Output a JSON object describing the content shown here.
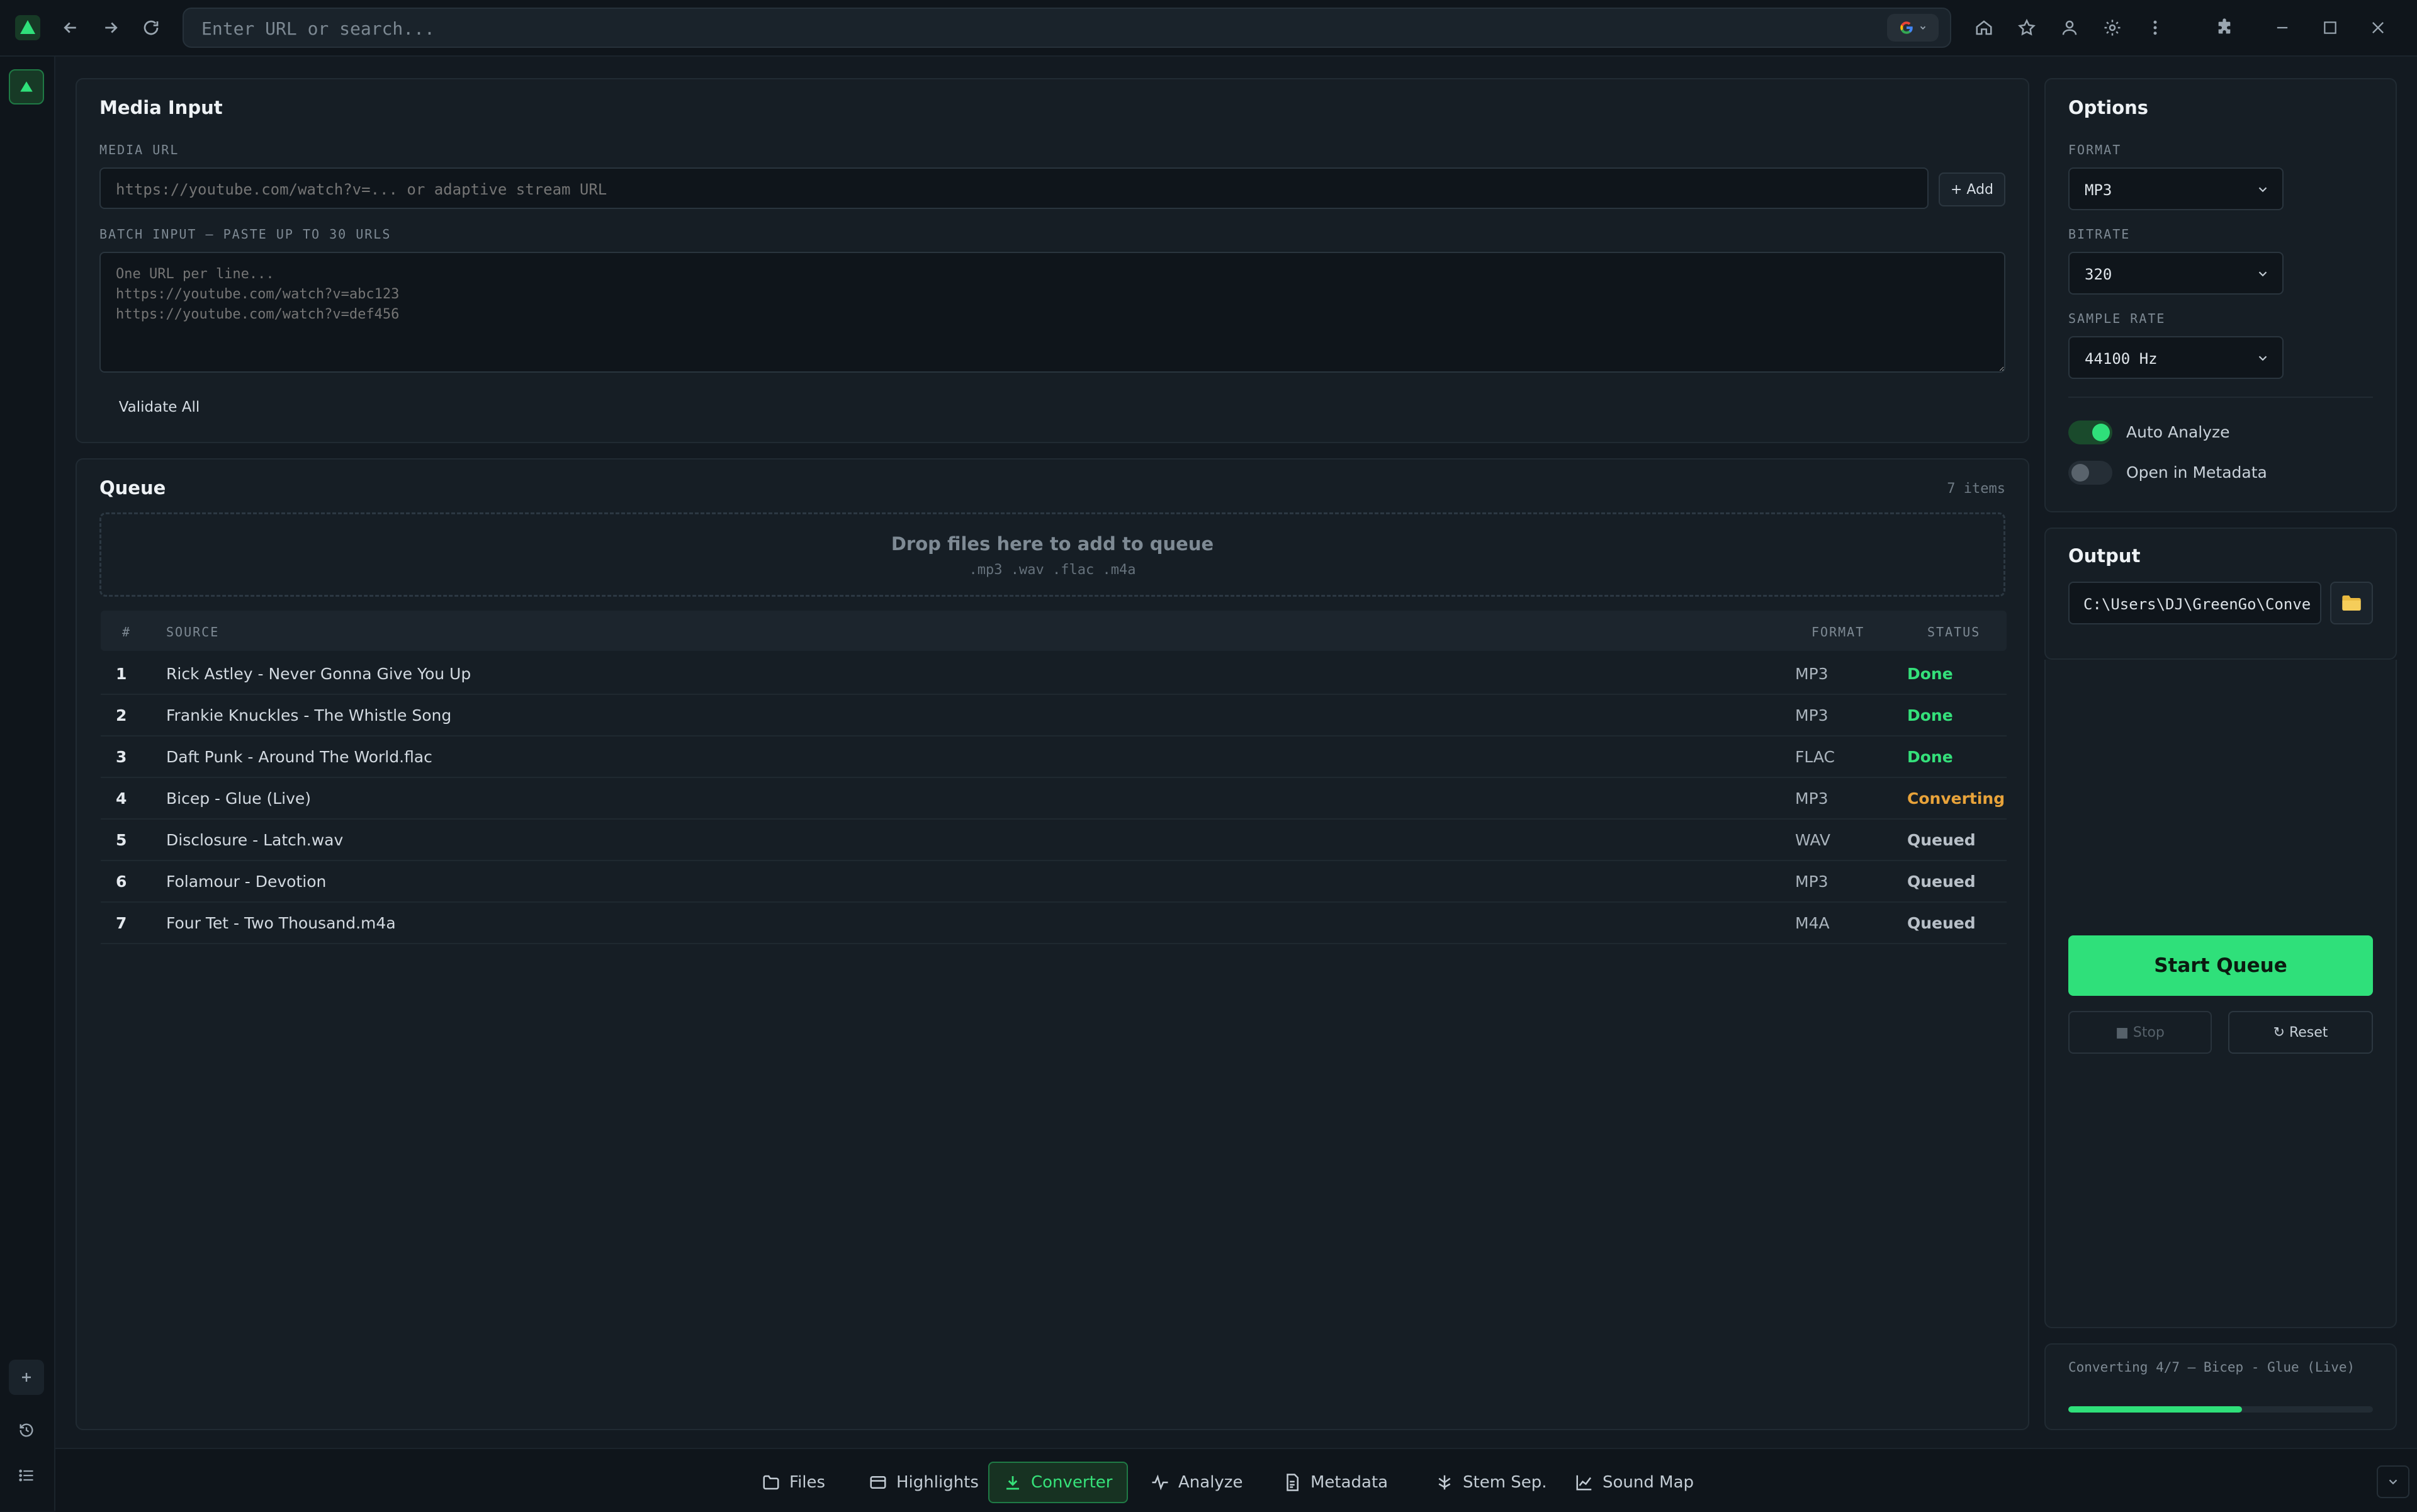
{
  "browser": {
    "url_placeholder": "Enter URL or search..."
  },
  "media_input": {
    "title": "Media Input",
    "media_url_label": "MEDIA URL",
    "media_url_placeholder": "https://youtube.com/watch?v=... or adaptive stream URL",
    "add_label": "+ Add",
    "batch_label": "BATCH INPUT — PASTE UP TO 30 URLS",
    "batch_placeholder": "One URL per line...\nhttps://youtube.com/watch?v=abc123\nhttps://youtube.com/watch?v=def456",
    "validate_label": "Validate All"
  },
  "queue": {
    "title": "Queue",
    "count": "7 items",
    "drop_title": "Drop files here to add to queue",
    "drop_formats": ".mp3 .wav .flac .m4a",
    "headers": {
      "num": "#",
      "source": "SOURCE",
      "format": "FORMAT",
      "status": "STATUS"
    },
    "rows": [
      {
        "num": "1",
        "source": "Rick Astley - Never Gonna Give You Up",
        "format": "MP3",
        "status": "Done"
      },
      {
        "num": "2",
        "source": "Frankie Knuckles - The Whistle Song",
        "format": "MP3",
        "status": "Done"
      },
      {
        "num": "3",
        "source": "Daft Punk - Around The World.flac",
        "format": "FLAC",
        "status": "Done"
      },
      {
        "num": "4",
        "source": "Bicep - Glue (Live)",
        "format": "MP3",
        "status": "Converting"
      },
      {
        "num": "5",
        "source": "Disclosure - Latch.wav",
        "format": "WAV",
        "status": "Queued"
      },
      {
        "num": "6",
        "source": "Folamour - Devotion",
        "format": "MP3",
        "status": "Queued"
      },
      {
        "num": "7",
        "source": "Four Tet - Two Thousand.m4a",
        "format": "M4A",
        "status": "Queued"
      }
    ]
  },
  "options": {
    "title": "Options",
    "format_label": "FORMAT",
    "format_value": "MP3",
    "bitrate_label": "BITRATE",
    "bitrate_value": "320",
    "sample_rate_label": "SAMPLE RATE",
    "sample_rate_value": "44100 Hz",
    "auto_analyze_label": "Auto Analyze",
    "auto_analyze_on": true,
    "open_metadata_label": "Open in Metadata",
    "open_metadata_on": false
  },
  "output": {
    "title": "Output",
    "path": "C:\\Users\\DJ\\GreenGo\\Conve"
  },
  "controls": {
    "start_label": "Start Queue",
    "stop_label": "■ Stop",
    "reset_label": "↻ Reset"
  },
  "progress": {
    "text": "Converting 4/7 — Bicep - Glue (Live)",
    "fraction": 0.57
  },
  "nav": {
    "tabs": [
      {
        "label": "Files",
        "icon": "folder-icon"
      },
      {
        "label": "Highlights",
        "icon": "highlights-icon"
      },
      {
        "label": "Converter",
        "icon": "download-icon",
        "active": true
      },
      {
        "label": "Analyze",
        "icon": "pulse-icon"
      },
      {
        "label": "Metadata",
        "icon": "document-icon"
      },
      {
        "label": "Stem Sep.",
        "icon": "split-icon"
      },
      {
        "label": "Sound Map",
        "icon": "chart-icon"
      }
    ]
  },
  "colors": {
    "accent": "#2fe07a",
    "done": "#34e07a",
    "converting": "#e8a33a",
    "queued": "#b8c0c8"
  }
}
